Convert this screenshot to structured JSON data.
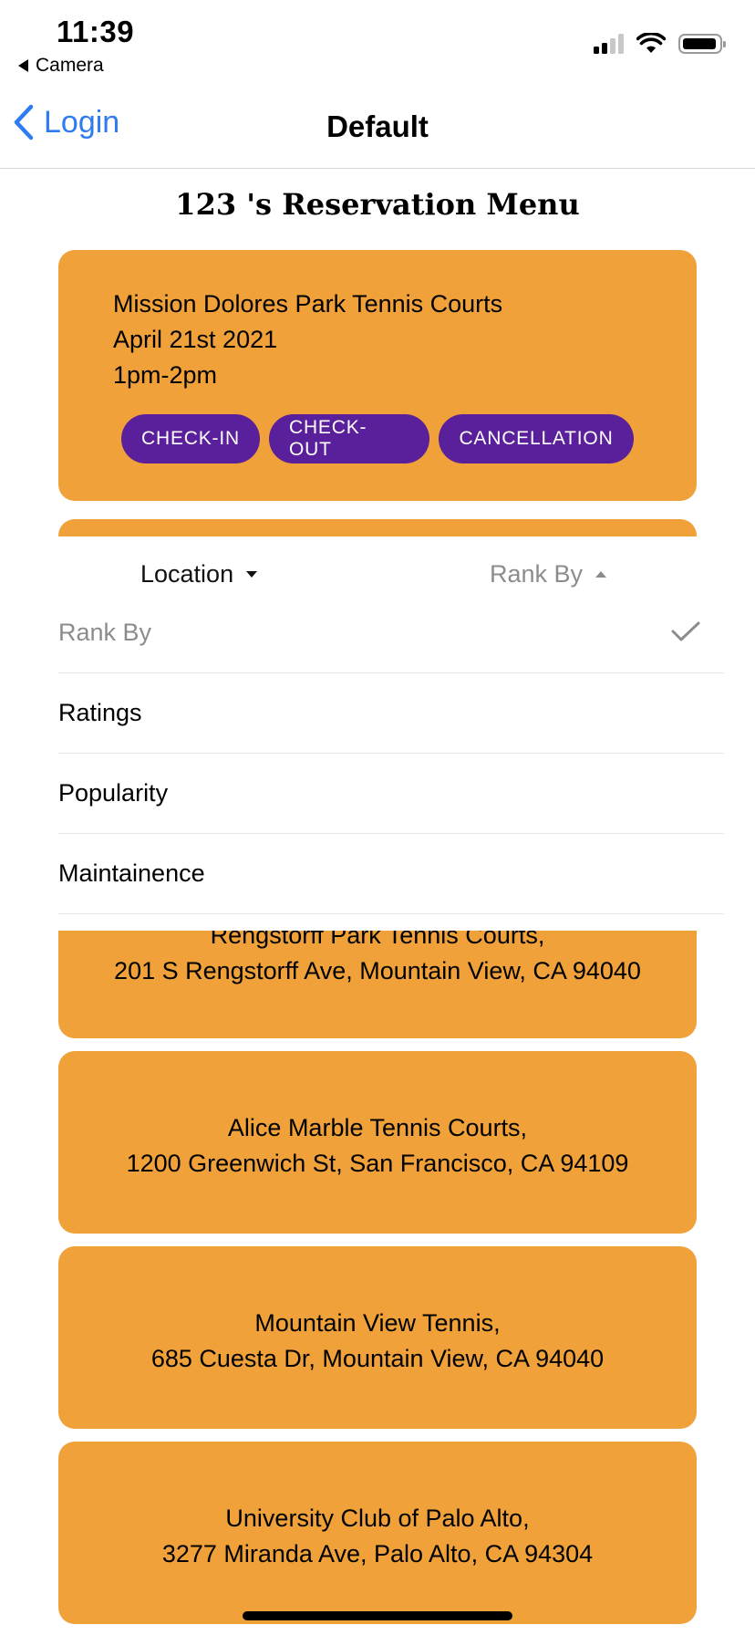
{
  "status_bar": {
    "time": "11:39",
    "back_app": "Camera"
  },
  "nav": {
    "back_label": "Login",
    "title": "Default"
  },
  "page_title": "123 's Reservation Menu",
  "reservation": {
    "court": "Mission Dolores Park Tennis Courts",
    "date": "April 21st 2021",
    "time": "1pm-2pm",
    "buttons": {
      "check_in": "CHECK-IN",
      "check_out": "CHECK-OUT",
      "cancel": "CANCELLATION"
    }
  },
  "filters": {
    "location": "Location",
    "rank_by": "Rank By"
  },
  "rank_options": [
    "Rank By",
    "Ratings",
    "Popularity",
    "Maintainence"
  ],
  "locations": [
    {
      "name": "Rengstorff Park Tennis Courts,",
      "address": "201 S Rengstorff Ave, Mountain View, CA 94040"
    },
    {
      "name": "Alice Marble Tennis Courts,",
      "address": "1200 Greenwich St, San Francisco, CA 94109"
    },
    {
      "name": "Mountain View Tennis,",
      "address": "685 Cuesta Dr, Mountain View, CA 94040"
    },
    {
      "name": "University Club of Palo Alto,",
      "address": "3277 Miranda Ave, Palo Alto, CA 94304"
    }
  ],
  "colors": {
    "card": "#f0a13a",
    "button": "#5a1f9a",
    "link": "#2f7bf0"
  }
}
